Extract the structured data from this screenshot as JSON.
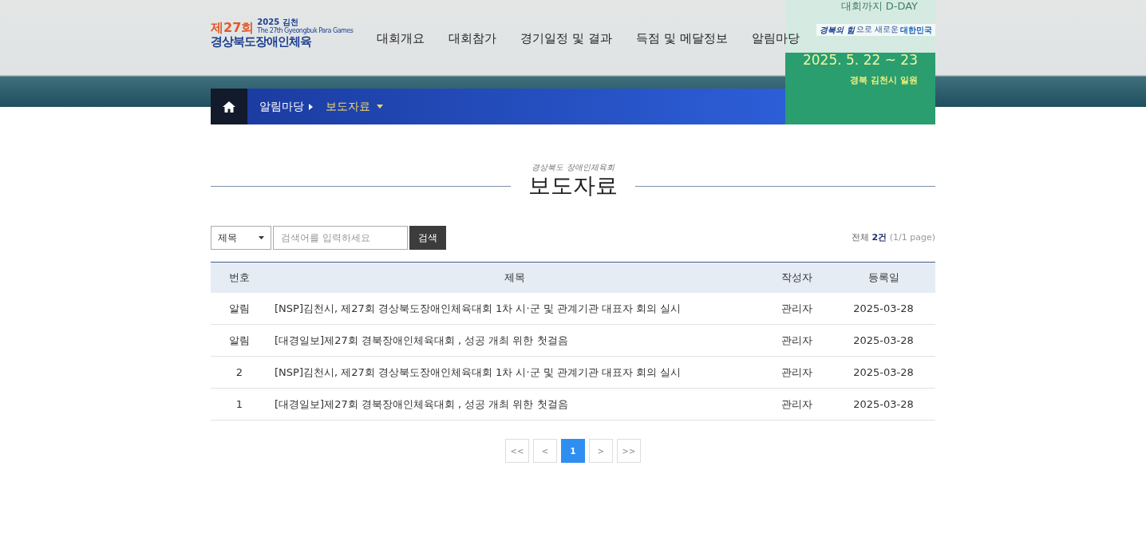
{
  "logo": {
    "edition": "제27회",
    "year": "2025 김천",
    "subtitle": "The 27th Gyeongbuk Para Games",
    "name": "경상북도장애인체육"
  },
  "nav": [
    {
      "label": "대회개요"
    },
    {
      "label": "대회참가"
    },
    {
      "label": "경기일정 및 결과"
    },
    {
      "label": "득점 및 메달정보"
    },
    {
      "label": "알림마당"
    }
  ],
  "dday": {
    "label": "대회까지 D-DAY",
    "slogan_a": "경북의 힘",
    "slogan_b": "으로 새로운",
    "slogan_c": "대한민국",
    "dates": "2025. 5. 22 ~ 23",
    "place": "경북 김천시 일원"
  },
  "breadcrumb": [
    {
      "label": "알림마당",
      "kind": "link"
    },
    {
      "label": "보도자료",
      "kind": "current"
    }
  ],
  "heading": {
    "kicker": "경상북도 장애인체육회",
    "title": "보도자료"
  },
  "search": {
    "field_select": "제목",
    "placeholder": "검색어를 입력하세요",
    "button": "검색"
  },
  "summary": {
    "prefix": "전체",
    "count": "2건",
    "pages": "(1/1 page)"
  },
  "table": {
    "columns": [
      "번호",
      "제목",
      "작성자",
      "등록일"
    ],
    "rows": [
      {
        "number": "알림",
        "title": "[NSP]김천시, 제27회 경상북도장애인체육대회 1차 시·군 및 관계기관 대표자 회의 실시",
        "author": "관리자",
        "date": "2025-03-28"
      },
      {
        "number": "알림",
        "title": "[대경일보]제27회 경북장애인체육대회 , 성공 개최 위한 첫걸음",
        "author": "관리자",
        "date": "2025-03-28"
      },
      {
        "number": "2",
        "title": "[NSP]김천시, 제27회 경상북도장애인체육대회 1차 시·군 및 관계기관 대표자 회의 실시",
        "author": "관리자",
        "date": "2025-03-28"
      },
      {
        "number": "1",
        "title": "[대경일보]제27회 경북장애인체육대회 , 성공 개최 위한 첫걸음",
        "author": "관리자",
        "date": "2025-03-28"
      }
    ]
  },
  "pagination": [
    {
      "label": "<<",
      "selected": false
    },
    {
      "label": "<",
      "selected": false
    },
    {
      "label": "1",
      "selected": true
    },
    {
      "label": ">",
      "selected": false
    },
    {
      "label": ">>",
      "selected": false
    }
  ]
}
